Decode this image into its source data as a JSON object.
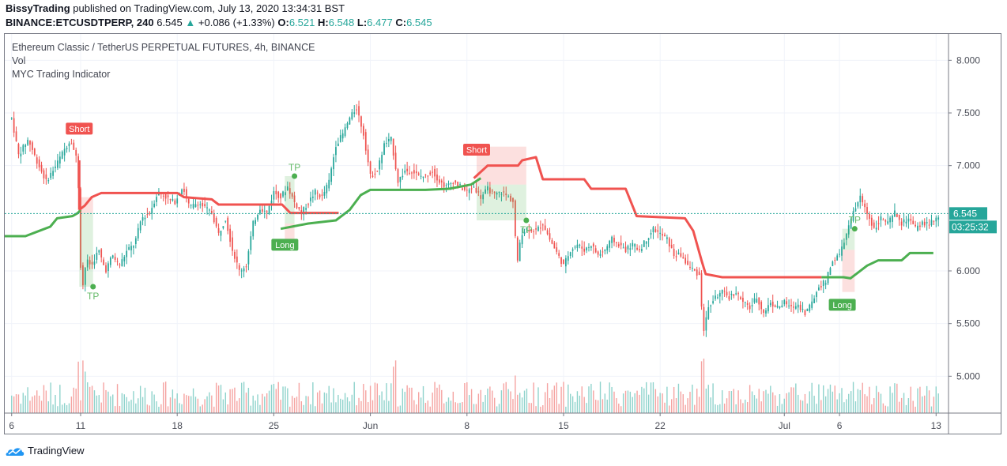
{
  "header": {
    "author": "BissyTrading",
    "published_text": "published on TradingView.com, July 13, 2020 13:34:31 BST",
    "symbol": "BINANCE:ETCUSDTPERP, 240",
    "last_price": "6.545",
    "change_arrow": "▲",
    "change": "+0.086 (+1.33%)",
    "open_label": "O:",
    "open": "6.521",
    "high_label": "H:",
    "high": "6.548",
    "low_label": "L:",
    "low": "6.477",
    "close_label": "C:",
    "close": "6.545"
  },
  "legend": {
    "main_series": "Ethereum Classic / TetherUS PERPETUAL FUTURES, 4h, BINANCE",
    "volume": "Vol",
    "indicator": "MYC Trading Indicator"
  },
  "price_badge": {
    "value": "6.545",
    "countdown": "03:25:32"
  },
  "footer": {
    "brand": "TradingView"
  },
  "colors": {
    "up": "#26a69a",
    "down": "#ef5350",
    "vol_up": "#8fd3cc",
    "vol_down": "#f5a3a1",
    "short_line": "#f05350",
    "long_line": "#4caf50",
    "badge": "#26a69a",
    "grid": "#f0f3fa",
    "axis": "#787b86"
  },
  "chart_data": {
    "type": "candlestick",
    "title": "Ethereum Classic / TetherUS PERPETUAL FUTURES, 4h, BINANCE",
    "interval": "4h",
    "ylim": [
      4.65,
      8.25
    ],
    "y_ticks": [
      "8.000",
      "7.500",
      "7.000",
      "6.000",
      "5.500",
      "5.000"
    ],
    "x_ticks": [
      "6",
      "11",
      "18",
      "25",
      "Jun",
      "8",
      "15",
      "22",
      "Jul",
      "6",
      "13"
    ],
    "x_tick_days": [
      0,
      5,
      12,
      19,
      26,
      33,
      40,
      47,
      56,
      60,
      67
    ],
    "days_span": [
      -0.5,
      67.9
    ],
    "last_price": 6.545,
    "price_path": [
      [
        0,
        7.45
      ],
      [
        0.5,
        7.1
      ],
      [
        1.2,
        7.25
      ],
      [
        1.8,
        7.05
      ],
      [
        2.5,
        6.85
      ],
      [
        3.2,
        7.0
      ],
      [
        3.8,
        7.15
      ],
      [
        4.3,
        7.25
      ],
      [
        4.6,
        7.1
      ],
      [
        4.8,
        7.05
      ],
      [
        4.9,
        6.3
      ],
      [
        5.1,
        5.8
      ],
      [
        5.4,
        6.1
      ],
      [
        5.8,
        6.05
      ],
      [
        6.3,
        6.2
      ],
      [
        6.8,
        6.0
      ],
      [
        7.3,
        6.15
      ],
      [
        7.8,
        6.05
      ],
      [
        8.4,
        6.2
      ],
      [
        8.9,
        6.25
      ],
      [
        9.4,
        6.5
      ],
      [
        10,
        6.55
      ],
      [
        10.6,
        6.75
      ],
      [
        11.2,
        6.7
      ],
      [
        11.8,
        6.65
      ],
      [
        12.4,
        6.8
      ],
      [
        12.9,
        6.6
      ],
      [
        13.5,
        6.65
      ],
      [
        14,
        6.6
      ],
      [
        14.5,
        6.55
      ],
      [
        15,
        6.35
      ],
      [
        15.5,
        6.5
      ],
      [
        16,
        6.2
      ],
      [
        16.5,
        6.0
      ],
      [
        17,
        6.05
      ],
      [
        17.5,
        6.45
      ],
      [
        18,
        6.6
      ],
      [
        18.5,
        6.55
      ],
      [
        19,
        6.75
      ],
      [
        19.5,
        6.7
      ],
      [
        20,
        6.8
      ],
      [
        20.5,
        6.65
      ],
      [
        21,
        6.55
      ],
      [
        21.5,
        6.65
      ],
      [
        22,
        6.75
      ],
      [
        22.5,
        6.7
      ],
      [
        23,
        6.85
      ],
      [
        23.5,
        7.2
      ],
      [
        24,
        7.3
      ],
      [
        24.5,
        7.45
      ],
      [
        25,
        7.55
      ],
      [
        25.5,
        7.3
      ],
      [
        26,
        6.9
      ],
      [
        26.5,
        6.95
      ],
      [
        27,
        7.2
      ],
      [
        27.5,
        7.25
      ],
      [
        28,
        6.85
      ],
      [
        28.5,
        6.95
      ],
      [
        29,
        6.95
      ],
      [
        29.5,
        6.9
      ],
      [
        30,
        6.9
      ],
      [
        30.5,
        6.95
      ],
      [
        31,
        6.85
      ],
      [
        31.5,
        6.8
      ],
      [
        32,
        6.85
      ],
      [
        32.5,
        6.8
      ],
      [
        33,
        6.75
      ],
      [
        33.5,
        6.8
      ],
      [
        34,
        6.7
      ],
      [
        34.5,
        6.78
      ],
      [
        35,
        6.72
      ],
      [
        35.5,
        6.75
      ],
      [
        36,
        6.7
      ],
      [
        36.4,
        6.65
      ],
      [
        36.6,
        6.0
      ],
      [
        36.9,
        6.35
      ],
      [
        37.3,
        6.4
      ],
      [
        38,
        6.38
      ],
      [
        38.5,
        6.45
      ],
      [
        39,
        6.3
      ],
      [
        39.6,
        6.15
      ],
      [
        40,
        6.05
      ],
      [
        40.5,
        6.2
      ],
      [
        41,
        6.25
      ],
      [
        41.5,
        6.2
      ],
      [
        42,
        6.25
      ],
      [
        42.5,
        6.15
      ],
      [
        43,
        6.2
      ],
      [
        43.5,
        6.3
      ],
      [
        44,
        6.25
      ],
      [
        44.5,
        6.2
      ],
      [
        45,
        6.25
      ],
      [
        45.5,
        6.2
      ],
      [
        46,
        6.3
      ],
      [
        46.5,
        6.4
      ],
      [
        47,
        6.35
      ],
      [
        47.5,
        6.3
      ],
      [
        48,
        6.15
      ],
      [
        48.5,
        6.15
      ],
      [
        49,
        6.05
      ],
      [
        49.5,
        6.0
      ],
      [
        49.9,
        5.95
      ],
      [
        50.1,
        5.4
      ],
      [
        50.5,
        5.65
      ],
      [
        51,
        5.75
      ],
      [
        51.5,
        5.8
      ],
      [
        52,
        5.75
      ],
      [
        52.5,
        5.8
      ],
      [
        53,
        5.7
      ],
      [
        53.5,
        5.65
      ],
      [
        54,
        5.75
      ],
      [
        54.5,
        5.6
      ],
      [
        55,
        5.7
      ],
      [
        55.5,
        5.65
      ],
      [
        56,
        5.7
      ],
      [
        56.5,
        5.65
      ],
      [
        57,
        5.68
      ],
      [
        57.5,
        5.6
      ],
      [
        58,
        5.7
      ],
      [
        58.5,
        5.85
      ],
      [
        59,
        5.9
      ],
      [
        59.5,
        6.1
      ],
      [
        60,
        6.15
      ],
      [
        60.5,
        6.35
      ],
      [
        61,
        6.55
      ],
      [
        61.5,
        6.7
      ],
      [
        62,
        6.55
      ],
      [
        62.5,
        6.4
      ],
      [
        63,
        6.5
      ],
      [
        63.5,
        6.45
      ],
      [
        64,
        6.55
      ],
      [
        64.5,
        6.45
      ],
      [
        65,
        6.5
      ],
      [
        65.5,
        6.4
      ],
      [
        66,
        6.45
      ],
      [
        66.5,
        6.45
      ],
      [
        67,
        6.48
      ],
      [
        67.3,
        6.545
      ]
    ],
    "short_stop_line": [
      [
        4.9,
        6.58
      ],
      [
        5.3,
        6.62
      ],
      [
        5.8,
        6.7
      ],
      [
        6.5,
        6.74
      ],
      [
        12,
        6.74
      ],
      [
        12.5,
        6.7
      ],
      [
        14.5,
        6.68
      ],
      [
        15,
        6.63
      ],
      [
        19.6,
        6.63
      ],
      [
        20.2,
        6.55
      ],
      [
        23.7,
        6.55
      ]
    ],
    "long_stop_line": [
      [
        -0.5,
        6.33
      ],
      [
        1,
        6.33
      ],
      [
        2,
        6.38
      ],
      [
        2.8,
        6.42
      ],
      [
        3.3,
        6.5
      ],
      [
        4.4,
        6.52
      ],
      [
        4.8,
        6.55
      ],
      [
        5.0,
        6.58
      ]
    ],
    "long_stop_line_2": [
      [
        19.5,
        6.4
      ],
      [
        20.3,
        6.42
      ],
      [
        21.5,
        6.45
      ],
      [
        23.5,
        6.48
      ],
      [
        24.5,
        6.58
      ],
      [
        25.3,
        6.72
      ],
      [
        26,
        6.77
      ],
      [
        30,
        6.77
      ],
      [
        31.7,
        6.78
      ],
      [
        33.3,
        6.82
      ],
      [
        34.0,
        6.88
      ]
    ],
    "short_stop_line_2": [
      [
        33.5,
        6.88
      ],
      [
        34.5,
        7.0
      ],
      [
        36.7,
        7.0
      ],
      [
        37.0,
        7.05
      ],
      [
        38.0,
        7.08
      ],
      [
        38.5,
        6.87
      ],
      [
        41.5,
        6.87
      ],
      [
        42.0,
        6.78
      ],
      [
        44.5,
        6.78
      ],
      [
        45.3,
        6.52
      ],
      [
        48.8,
        6.5
      ],
      [
        49.4,
        6.38
      ],
      [
        50,
        6.1
      ],
      [
        50.3,
        5.97
      ],
      [
        51.5,
        5.94
      ],
      [
        58.7,
        5.94
      ]
    ],
    "long_stop_line_3": [
      [
        58.7,
        5.94
      ],
      [
        60.3,
        5.94
      ],
      [
        60.8,
        5.93
      ],
      [
        61.3,
        5.98
      ],
      [
        62,
        6.05
      ],
      [
        62.8,
        6.1
      ],
      [
        64.5,
        6.1
      ],
      [
        65.1,
        6.17
      ],
      [
        66.8,
        6.17
      ]
    ],
    "signals": [
      {
        "type": "Short",
        "day": 4.9,
        "price": 7.25,
        "entry": 6.55,
        "stop": 6.7,
        "tp": 5.85,
        "tp_day": 5.9
      },
      {
        "type": "Long",
        "day": 19.8,
        "price": 6.35,
        "entry": 6.45,
        "stop": 6.25,
        "tp": 6.9,
        "tp_day": 20.5
      },
      {
        "type": "Short",
        "day": 33.7,
        "price": 7.05,
        "entry": 6.82,
        "stop": 7.18,
        "tp": 6.48,
        "tp_day": 37.3
      },
      {
        "type": "Long",
        "day": 60.2,
        "price": 5.78,
        "entry": 6.2,
        "stop": 5.8,
        "tp": 6.4,
        "tp_day": 61.1
      }
    ],
    "tp_label": "TP",
    "volume_ylim": [
      0,
      1
    ]
  }
}
